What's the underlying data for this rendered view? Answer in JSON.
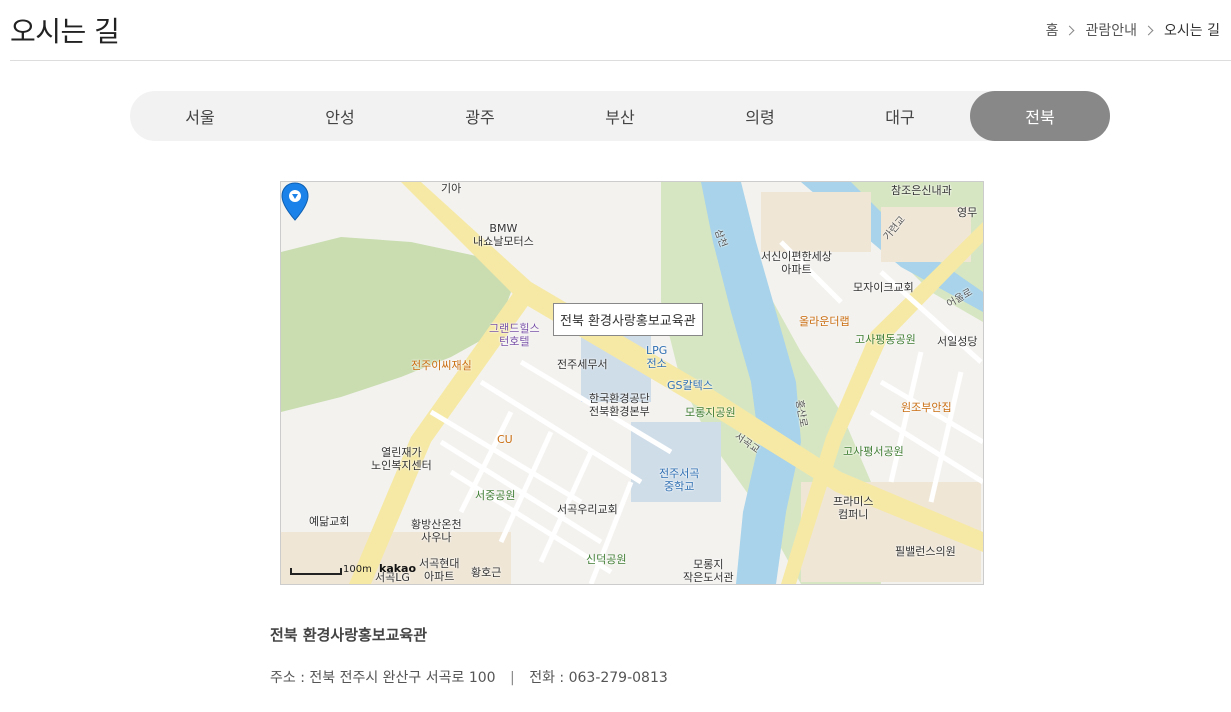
{
  "header": {
    "title": "오시는 길",
    "breadcrumb": [
      "홈",
      "관람안내",
      "오시는 길"
    ]
  },
  "tabs": [
    {
      "label": "서울",
      "active": false
    },
    {
      "label": "안성",
      "active": false
    },
    {
      "label": "광주",
      "active": false
    },
    {
      "label": "부산",
      "active": false
    },
    {
      "label": "의령",
      "active": false
    },
    {
      "label": "대구",
      "active": false
    },
    {
      "label": "전북",
      "active": true
    }
  ],
  "map": {
    "info_window": "전북 환경사랑홍보교육관",
    "scale_label": "100m",
    "logo": "kakao",
    "labels": {
      "kia": "기아",
      "bmw": "BMW\n내쇼날모터스",
      "grandhills": "그랜드힐스\n턴호텔",
      "jeonju_isijaesil": "전주이씨재실",
      "jeonju_tax": "전주세무서",
      "keco": "한국환경공단\n전북환경본부",
      "lpg": "LPG\n전소",
      "gs": "GS칼텍스",
      "morongji_park": "모롱지공원",
      "cu": "CU",
      "yeollin": "열린재가\n노인복지센터",
      "seojung_park": "서중공원",
      "seogok_church": "서곡우리교회",
      "yedam": "예닮교회",
      "hwangbang": "황방산온천\n사우나",
      "seogok_hyundai": "서곡현대\n아파트",
      "seogok_lg": "서곡LG",
      "hwanggeun": "황호근",
      "sinduk_park": "신덕공원",
      "morongji_library": "모롱지\n작은도서관",
      "seogok_middle": "전주서곡\n중학교",
      "seogok_bridge": "서곡교",
      "samcheon": "삼천",
      "chamjoeun": "참조은신내과",
      "seosin_apt": "서신이편한세상\n아파트",
      "mosaic_church": "모자이크교회",
      "olaun": "올라운더랩",
      "gosa_pyeongdong": "고사평동공원",
      "seoil_church": "서일성당",
      "wonjo": "원조부안집",
      "gosa_pyeongseo": "고사평서공원",
      "primus": "프라미스\n컴퍼니",
      "philbellence": "필밸런스의원",
      "youngmu": "영무",
      "garyeongyo": "가련교",
      "eodeullo": "어울로",
      "hongsanro": "홍산로"
    }
  },
  "place": {
    "name": "전북 환경사랑홍보교육관",
    "address_label": "주소 : 전북 전주시 완산구 서곡로 100",
    "phone_label": "전화 : 063-279-0813"
  }
}
